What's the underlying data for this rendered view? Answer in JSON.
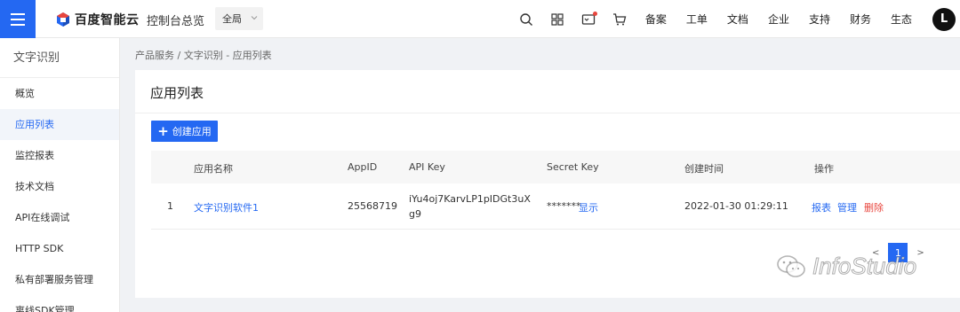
{
  "header": {
    "logo_text": "百度智能云",
    "console_title": "控制台总览",
    "region": "全局",
    "nav_links": [
      "备案",
      "工单",
      "文档",
      "企业",
      "支持",
      "财务",
      "生态"
    ],
    "avatar_letter": "L",
    "icons": [
      "search-icon",
      "grid-icon",
      "message-icon",
      "cart-icon"
    ]
  },
  "sidebar": {
    "title": "文字识别",
    "items": [
      {
        "label": "概览"
      },
      {
        "label": "应用列表"
      },
      {
        "label": "监控报表"
      },
      {
        "label": "技术文档"
      },
      {
        "label": "API在线调试"
      },
      {
        "label": "HTTP SDK"
      },
      {
        "label": "私有部署服务管理"
      },
      {
        "label": "离线SDK管理"
      }
    ],
    "active_index": 1
  },
  "breadcrumb": "产品服务 / 文字识别 - 应用列表",
  "main": {
    "title": "应用列表",
    "create_button": "创建应用",
    "table": {
      "headers": [
        "应用名称",
        "AppID",
        "API Key",
        "Secret Key",
        "创建时间",
        "操作"
      ],
      "rows": [
        {
          "index": "1",
          "name": "文字识别软件1",
          "app_id": "25568719",
          "api_key": "iYu4oj7KarvLP1pIDGt3uXg9",
          "secret_key": "*******",
          "secret_show": "显示",
          "created": "2022-01-30 01:29:11",
          "actions": [
            "报表",
            "管理",
            "删除"
          ]
        }
      ]
    },
    "pagination": {
      "prev": "<",
      "current": "1",
      "next": ">"
    }
  },
  "watermark": "InfoStudio",
  "colors": {
    "accent": "#2468f2",
    "danger": "#e8463e"
  }
}
